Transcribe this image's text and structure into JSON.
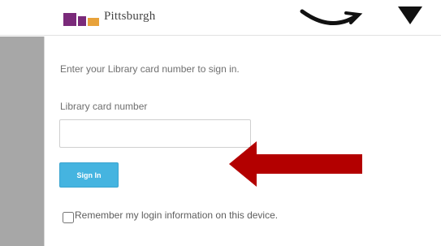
{
  "header": {
    "logo_text": "Pittsburgh",
    "colors": {
      "logo_purple": "#7a2a7a",
      "logo_orange": "#e8a23a"
    }
  },
  "signin_form": {
    "intro_text": "Enter your Library card number to sign in.",
    "card_number_label": "Library card number",
    "card_number_value": "",
    "signin_button_label": "Sign In",
    "remember_label": "Remember my login information on this device.",
    "remember_checked": false
  },
  "annotation": {
    "arrow_color": "#b30000",
    "arrow_direction": "left"
  },
  "colors": {
    "button": "#45b4e0",
    "gutter": "#a7a7a7",
    "text": "#6f6f6f"
  }
}
